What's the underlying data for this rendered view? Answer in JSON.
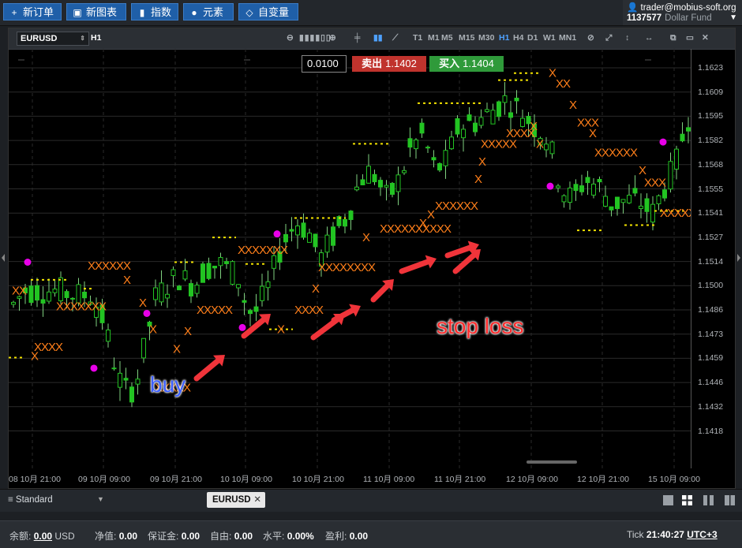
{
  "toolbar": {
    "new_order": "新订单",
    "new_chart": "新图表",
    "indicators": "指数",
    "elements": "元素",
    "custom_var": "自变量"
  },
  "account": {
    "user": "trader@mobius-soft.org",
    "number": "1137577",
    "fund": "Dollar Fund"
  },
  "chart": {
    "symbol": "EURUSD",
    "period": "H1",
    "timeframes": [
      "T1",
      "M1",
      "M5",
      "M15",
      "M30",
      "H1",
      "H4",
      "D1",
      "W1",
      "MN1"
    ],
    "active_timeframe": "H1",
    "lot": "0.0100",
    "sell_label": "卖出",
    "sell_price": "1.1402",
    "buy_label": "买入",
    "buy_price": "1.1404",
    "price_ticks": [
      "1.1623",
      "1.1609",
      "1.1595",
      "1.1582",
      "1.1568",
      "1.1555",
      "1.1541",
      "1.1527",
      "1.1514",
      "1.1500",
      "1.1486",
      "1.1473",
      "1.1459",
      "1.1446",
      "1.1432",
      "1.1418"
    ],
    "time_ticks": [
      "08 10月 21:00",
      "09 10月 09:00",
      "09 10月 21:00",
      "10 10月 09:00",
      "10 10月 21:00",
      "11 10月 09:00",
      "11 10月 21:00",
      "12 10月 09:00",
      "12 10月 21:00",
      "15 10月 09:00"
    ]
  },
  "annotations": {
    "buy": "buy",
    "stop_loss": "stop loss"
  },
  "bottom": {
    "template": "Standard",
    "tab": "EURUSD"
  },
  "status": {
    "balance_label": "余额:",
    "balance": "0.00",
    "currency": "USD",
    "equity_label": "净值:",
    "equity": "0.00",
    "margin_label": "保证金:",
    "margin": "0.00",
    "free_label": "自由:",
    "free": "0.00",
    "level_label": "水平:",
    "level": "0.00%",
    "profit_label": "盈利:",
    "profit": "0.00",
    "tick_label": "Tick",
    "time": "21:40:27",
    "tz": "UTC+3"
  },
  "colors": {
    "bull": "#22c422",
    "bear": "#22c422",
    "dots": "#e800e8",
    "stops": "#ff7f1a",
    "levels": "#f2e200",
    "arrows": "#f0343a"
  }
}
